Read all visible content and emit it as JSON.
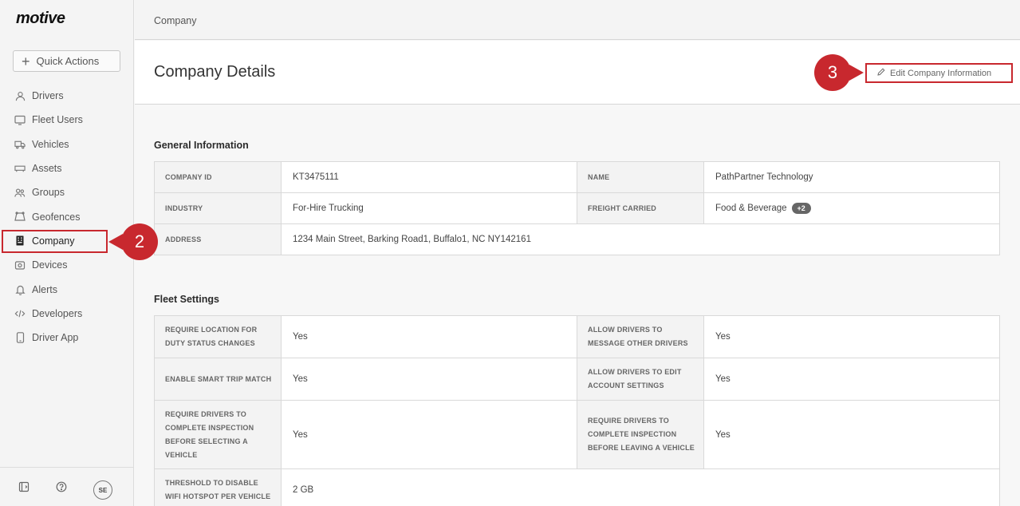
{
  "app": {
    "logo": "motive"
  },
  "sidebar": {
    "quick_actions": "Quick Actions",
    "items": [
      {
        "label": "Drivers",
        "icon": "person-icon"
      },
      {
        "label": "Fleet Users",
        "icon": "monitor-icon"
      },
      {
        "label": "Vehicles",
        "icon": "truck-icon"
      },
      {
        "label": "Assets",
        "icon": "trailer-icon"
      },
      {
        "label": "Groups",
        "icon": "group-icon"
      },
      {
        "label": "Geofences",
        "icon": "geofence-icon"
      },
      {
        "label": "Company",
        "icon": "building-icon",
        "active": true
      },
      {
        "label": "Devices",
        "icon": "device-icon"
      },
      {
        "label": "Alerts",
        "icon": "bell-icon"
      },
      {
        "label": "Developers",
        "icon": "code-icon"
      },
      {
        "label": "Driver App",
        "icon": "phone-icon"
      }
    ],
    "avatar_initials": "SE"
  },
  "callouts": {
    "step2": "2",
    "step3": "3"
  },
  "breadcrumb": "Company",
  "page": {
    "title": "Company Details",
    "edit_button": "Edit Company Information"
  },
  "general": {
    "title": "General Information",
    "company_id_label": "COMPANY ID",
    "company_id": "KT3475111",
    "name_label": "NAME",
    "name": "PathPartner Technology",
    "industry_label": "INDUSTRY",
    "industry": "For-Hire Trucking",
    "freight_label": "FREIGHT CARRIED",
    "freight": "Food & Beverage",
    "freight_more": "+2",
    "address_label": "ADDRESS",
    "address": "1234 Main Street, Barking Road1, Buffalo1, NC NY142161"
  },
  "fleet": {
    "title": "Fleet Settings",
    "r1_l1": "REQUIRE LOCATION FOR DUTY STATUS CHANGES",
    "r1_v1": "Yes",
    "r1_l2": "ALLOW DRIVERS TO MESSAGE OTHER DRIVERS",
    "r1_v2": "Yes",
    "r2_l1": "ENABLE SMART TRIP MATCH",
    "r2_v1": "Yes",
    "r2_l2": "ALLOW DRIVERS TO EDIT ACCOUNT SETTINGS",
    "r2_v2": "Yes",
    "r3_l1": "REQUIRE DRIVERS TO COMPLETE INSPECTION BEFORE SELECTING A VEHICLE",
    "r3_v1": "Yes",
    "r3_l2": "REQUIRE DRIVERS TO COMPLETE INSPECTION BEFORE LEAVING A VEHICLE",
    "r3_v2": "Yes",
    "r4_l1": "THRESHOLD TO DISABLE WIFI HOTSPOT PER VEHICLE",
    "r4_v1": "2 GB"
  },
  "colors": {
    "accent": "#c8282e",
    "badge": "#666666"
  }
}
